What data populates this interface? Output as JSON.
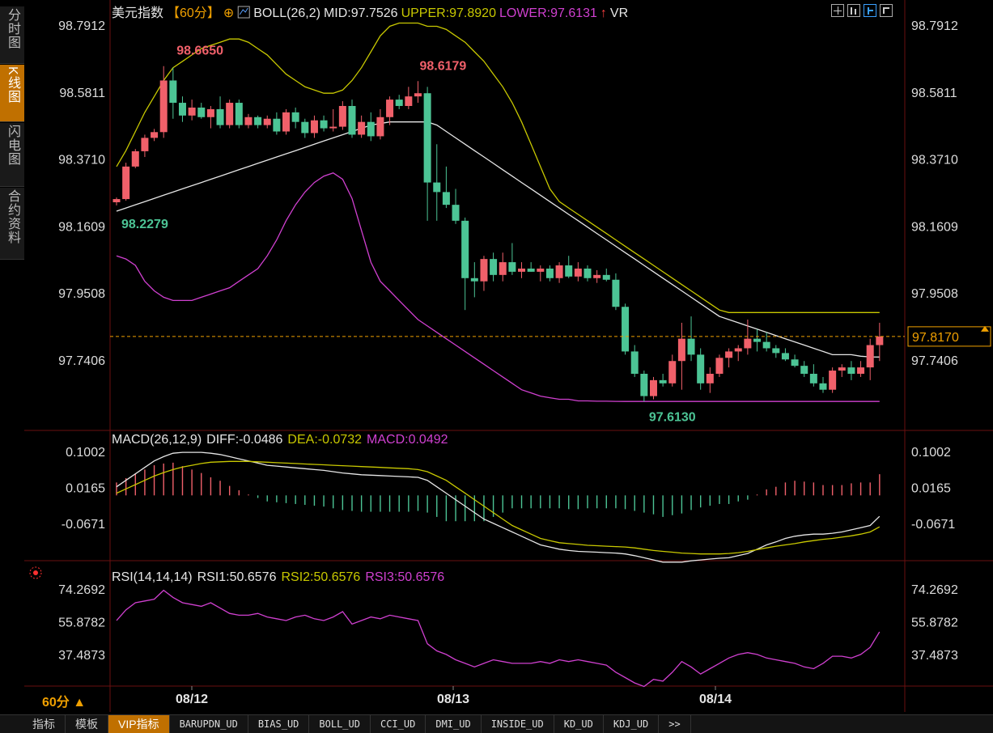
{
  "sidebar": [
    {
      "label": "分时图",
      "active": false
    },
    {
      "label": "K线图",
      "active": true
    },
    {
      "label": "闪电图",
      "active": false
    },
    {
      "label": "合约资料",
      "active": false
    }
  ],
  "header": {
    "title": "美元指数",
    "period": "【60分】",
    "plus_icon": "⊕",
    "boll_label": "BOLL(26,2)",
    "mid": "MID:97.7526",
    "upper": "UPPER:97.8920",
    "lower": "LOWER:97.6131",
    "vr_arrow": "↑",
    "vr": "VR"
  },
  "toolbar_icons": [
    "crosshair-icon",
    "bar-style-icon",
    "cursor-icon",
    "expand-icon"
  ],
  "colors": {
    "up": "#f0606a",
    "down": "#4cc495",
    "mid": "#e6e6e6",
    "upper": "#c8c800",
    "lower": "#d040d0",
    "dea": "#c8c800",
    "diff": "#e6e6e6",
    "rsi": "#d040d0",
    "last_price": "#f0a000",
    "axis_text": "#dddddd"
  },
  "main_axis": {
    "ticks": [
      "98.7912",
      "98.5811",
      "98.3710",
      "98.1609",
      "97.9508",
      "97.7406"
    ],
    "last_price": "97.8170"
  },
  "price_annotations": [
    {
      "text": "98.6650",
      "type": "high"
    },
    {
      "text": "98.6179",
      "type": "high"
    },
    {
      "text": "98.2279",
      "type": "low"
    },
    {
      "text": "97.6130",
      "type": "low"
    }
  ],
  "macd_header": {
    "label": "MACD(26,12,9)",
    "diff": "DIFF:-0.0486",
    "dea": "DEA:-0.0732",
    "macd": "MACD:0.0492"
  },
  "macd_axis": {
    "ticks": [
      "0.1002",
      "0.0165",
      "-0.0671"
    ]
  },
  "rsi_header": {
    "icon": "settings-icon",
    "label": "RSI(14,14,14)",
    "rsi1": "RSI1:50.6576",
    "rsi2": "RSI2:50.6576",
    "rsi3": "RSI3:50.6576"
  },
  "rsi_axis": {
    "ticks": [
      "74.2692",
      "55.8782",
      "37.4873"
    ]
  },
  "x_axis": {
    "period_label": "60分 ▲",
    "dates": [
      "08/12",
      "08/13",
      "08/14"
    ]
  },
  "bottom_tabs": [
    "指标",
    "模板",
    "VIP指标",
    "BARUPDN_UD",
    "BIAS_UD",
    "BOLL_UD",
    "CCI_UD",
    "DMI_UD",
    "INSIDE_UD",
    "KD_UD",
    "KDJ_UD",
    ">>"
  ],
  "chart_data": [
    {
      "type": "candlestick",
      "title": "美元指数 60分",
      "ylim": [
        97.613,
        98.7912
      ],
      "candles": [
        {
          "o": 98.238,
          "h": 98.253,
          "l": 98.228,
          "c": 98.248
        },
        {
          "o": 98.248,
          "h": 98.362,
          "l": 98.243,
          "c": 98.35
        },
        {
          "o": 98.35,
          "h": 98.405,
          "l": 98.345,
          "c": 98.398
        },
        {
          "o": 98.398,
          "h": 98.45,
          "l": 98.38,
          "c": 98.44
        },
        {
          "o": 98.44,
          "h": 98.468,
          "l": 98.43,
          "c": 98.458
        },
        {
          "o": 98.458,
          "h": 98.665,
          "l": 98.44,
          "c": 98.62
        },
        {
          "o": 98.62,
          "h": 98.66,
          "l": 98.5,
          "c": 98.55
        },
        {
          "o": 98.55,
          "h": 98.57,
          "l": 98.49,
          "c": 98.51
        },
        {
          "o": 98.51,
          "h": 98.56,
          "l": 98.495,
          "c": 98.535
        },
        {
          "o": 98.535,
          "h": 98.55,
          "l": 98.5,
          "c": 98.505
        },
        {
          "o": 98.505,
          "h": 98.54,
          "l": 98.47,
          "c": 98.53
        },
        {
          "o": 98.53,
          "h": 98.57,
          "l": 98.47,
          "c": 98.48
        },
        {
          "o": 98.48,
          "h": 98.56,
          "l": 98.47,
          "c": 98.55
        },
        {
          "o": 98.55,
          "h": 98.56,
          "l": 98.47,
          "c": 98.48
        },
        {
          "o": 98.48,
          "h": 98.515,
          "l": 98.47,
          "c": 98.505
        },
        {
          "o": 98.505,
          "h": 98.51,
          "l": 98.47,
          "c": 98.48
        },
        {
          "o": 98.48,
          "h": 98.51,
          "l": 98.47,
          "c": 98.5
        },
        {
          "o": 98.5,
          "h": 98.52,
          "l": 98.45,
          "c": 98.46
        },
        {
          "o": 98.46,
          "h": 98.53,
          "l": 98.45,
          "c": 98.52
        },
        {
          "o": 98.52,
          "h": 98.535,
          "l": 98.47,
          "c": 98.49
        },
        {
          "o": 98.49,
          "h": 98.5,
          "l": 98.44,
          "c": 98.455
        },
        {
          "o": 98.455,
          "h": 98.51,
          "l": 98.44,
          "c": 98.495
        },
        {
          "o": 98.495,
          "h": 98.51,
          "l": 98.46,
          "c": 98.47
        },
        {
          "o": 98.47,
          "h": 98.53,
          "l": 98.46,
          "c": 98.475
        },
        {
          "o": 98.475,
          "h": 98.555,
          "l": 98.465,
          "c": 98.54
        },
        {
          "o": 98.54,
          "h": 98.56,
          "l": 98.44,
          "c": 98.45
        },
        {
          "o": 98.45,
          "h": 98.51,
          "l": 98.44,
          "c": 98.49
        },
        {
          "o": 98.49,
          "h": 98.52,
          "l": 98.43,
          "c": 98.445
        },
        {
          "o": 98.445,
          "h": 98.53,
          "l": 98.435,
          "c": 98.505
        },
        {
          "o": 98.505,
          "h": 98.57,
          "l": 98.48,
          "c": 98.56
        },
        {
          "o": 98.56,
          "h": 98.575,
          "l": 98.53,
          "c": 98.54
        },
        {
          "o": 98.54,
          "h": 98.6,
          "l": 98.53,
          "c": 98.57
        },
        {
          "o": 98.57,
          "h": 98.618,
          "l": 98.55,
          "c": 98.58
        },
        {
          "o": 98.58,
          "h": 98.6,
          "l": 98.18,
          "c": 98.3
        },
        {
          "o": 98.3,
          "h": 98.42,
          "l": 98.18,
          "c": 98.27
        },
        {
          "o": 98.27,
          "h": 98.35,
          "l": 98.22,
          "c": 98.23
        },
        {
          "o": 98.23,
          "h": 98.28,
          "l": 98.17,
          "c": 98.18
        },
        {
          "o": 98.18,
          "h": 98.19,
          "l": 97.9,
          "c": 98.0
        },
        {
          "o": 98.0,
          "h": 98.05,
          "l": 97.94,
          "c": 97.99
        },
        {
          "o": 97.99,
          "h": 98.07,
          "l": 97.96,
          "c": 98.06
        },
        {
          "o": 98.06,
          "h": 98.08,
          "l": 97.99,
          "c": 98.01
        },
        {
          "o": 98.01,
          "h": 98.08,
          "l": 97.99,
          "c": 98.05
        },
        {
          "o": 98.05,
          "h": 98.11,
          "l": 98.01,
          "c": 98.02
        },
        {
          "o": 98.02,
          "h": 98.05,
          "l": 98.0,
          "c": 98.03
        },
        {
          "o": 98.03,
          "h": 98.05,
          "l": 98.02,
          "c": 98.02
        },
        {
          "o": 98.02,
          "h": 98.04,
          "l": 97.99,
          "c": 98.03
        },
        {
          "o": 98.03,
          "h": 98.04,
          "l": 97.99,
          "c": 98.0
        },
        {
          "o": 98.0,
          "h": 98.05,
          "l": 97.985,
          "c": 98.04
        },
        {
          "o": 98.04,
          "h": 98.07,
          "l": 98.0,
          "c": 98.005
        },
        {
          "o": 98.005,
          "h": 98.05,
          "l": 97.99,
          "c": 98.03
        },
        {
          "o": 98.03,
          "h": 98.04,
          "l": 97.99,
          "c": 98.0
        },
        {
          "o": 98.0,
          "h": 98.025,
          "l": 97.985,
          "c": 98.01
        },
        {
          "o": 98.01,
          "h": 98.03,
          "l": 97.99,
          "c": 97.995
        },
        {
          "o": 97.995,
          "h": 98.015,
          "l": 97.9,
          "c": 97.91
        },
        {
          "o": 97.91,
          "h": 97.92,
          "l": 97.76,
          "c": 97.77
        },
        {
          "o": 97.77,
          "h": 97.79,
          "l": 97.69,
          "c": 97.7
        },
        {
          "o": 97.7,
          "h": 97.71,
          "l": 97.613,
          "c": 97.63
        },
        {
          "o": 97.63,
          "h": 97.69,
          "l": 97.62,
          "c": 97.68
        },
        {
          "o": 97.68,
          "h": 97.7,
          "l": 97.66,
          "c": 97.67
        },
        {
          "o": 97.67,
          "h": 97.76,
          "l": 97.66,
          "c": 97.74
        },
        {
          "o": 97.74,
          "h": 97.86,
          "l": 97.65,
          "c": 97.81
        },
        {
          "o": 97.81,
          "h": 97.88,
          "l": 97.74,
          "c": 97.76
        },
        {
          "o": 97.76,
          "h": 97.78,
          "l": 97.65,
          "c": 97.67
        },
        {
          "o": 97.67,
          "h": 97.72,
          "l": 97.64,
          "c": 97.7
        },
        {
          "o": 97.7,
          "h": 97.76,
          "l": 97.69,
          "c": 97.75
        },
        {
          "o": 97.75,
          "h": 97.78,
          "l": 97.72,
          "c": 97.77
        },
        {
          "o": 97.77,
          "h": 97.79,
          "l": 97.74,
          "c": 97.78
        },
        {
          "o": 97.78,
          "h": 97.87,
          "l": 97.76,
          "c": 97.81
        },
        {
          "o": 97.81,
          "h": 97.84,
          "l": 97.77,
          "c": 97.8
        },
        {
          "o": 97.8,
          "h": 97.83,
          "l": 97.77,
          "c": 97.78
        },
        {
          "o": 97.78,
          "h": 97.79,
          "l": 97.75,
          "c": 97.765
        },
        {
          "o": 97.765,
          "h": 97.78,
          "l": 97.74,
          "c": 97.745
        },
        {
          "o": 97.745,
          "h": 97.76,
          "l": 97.72,
          "c": 97.725
        },
        {
          "o": 97.725,
          "h": 97.74,
          "l": 97.69,
          "c": 97.7
        },
        {
          "o": 97.7,
          "h": 97.73,
          "l": 97.66,
          "c": 97.67
        },
        {
          "o": 97.67,
          "h": 97.69,
          "l": 97.64,
          "c": 97.65
        },
        {
          "o": 97.65,
          "h": 97.72,
          "l": 97.64,
          "c": 97.71
        },
        {
          "o": 97.71,
          "h": 97.73,
          "l": 97.69,
          "c": 97.72
        },
        {
          "o": 97.72,
          "h": 97.74,
          "l": 97.68,
          "c": 97.7
        },
        {
          "o": 97.7,
          "h": 97.74,
          "l": 97.69,
          "c": 97.72
        },
        {
          "o": 97.72,
          "h": 97.81,
          "l": 97.68,
          "c": 97.79
        },
        {
          "o": 97.79,
          "h": 97.86,
          "l": 97.74,
          "c": 97.817
        }
      ],
      "mid": [
        98.21,
        98.22,
        98.23,
        98.24,
        98.25,
        98.26,
        98.27,
        98.28,
        98.29,
        98.3,
        98.31,
        98.32,
        98.33,
        98.34,
        98.35,
        98.36,
        98.37,
        98.38,
        98.39,
        98.4,
        98.41,
        98.42,
        98.43,
        98.44,
        98.45,
        98.46,
        98.47,
        98.48,
        98.485,
        98.49,
        98.49,
        98.49,
        98.49,
        98.49,
        98.48,
        98.46,
        98.44,
        98.42,
        98.4,
        98.38,
        98.36,
        98.34,
        98.32,
        98.3,
        98.28,
        98.26,
        98.24,
        98.22,
        98.2,
        98.18,
        98.16,
        98.14,
        98.12,
        98.1,
        98.08,
        98.06,
        98.04,
        98.02,
        98.0,
        97.98,
        97.96,
        97.94,
        97.92,
        97.9,
        97.88,
        97.87,
        97.86,
        97.85,
        97.84,
        97.83,
        97.82,
        97.81,
        97.8,
        97.79,
        97.78,
        97.77,
        97.76,
        97.76,
        97.76,
        97.755,
        97.753,
        97.7526
      ],
      "upper": [
        98.35,
        98.4,
        98.46,
        98.52,
        98.57,
        98.62,
        98.66,
        98.68,
        98.7,
        98.72,
        98.73,
        98.74,
        98.75,
        98.75,
        98.74,
        98.72,
        98.7,
        98.67,
        98.64,
        98.62,
        98.6,
        98.59,
        98.58,
        98.58,
        98.59,
        98.62,
        98.66,
        98.71,
        98.76,
        98.79,
        98.8,
        98.8,
        98.8,
        98.79,
        98.79,
        98.78,
        98.76,
        98.74,
        98.71,
        98.68,
        98.64,
        98.6,
        98.55,
        98.49,
        98.42,
        98.35,
        98.28,
        98.24,
        98.22,
        98.2,
        98.18,
        98.16,
        98.14,
        98.12,
        98.1,
        98.08,
        98.06,
        98.04,
        98.02,
        98.0,
        97.98,
        97.96,
        97.94,
        97.92,
        97.9,
        97.892,
        97.892,
        97.892,
        97.892,
        97.892,
        97.892,
        97.892,
        97.892,
        97.892,
        97.892,
        97.892,
        97.892,
        97.892,
        97.892,
        97.892,
        97.892,
        97.892
      ],
      "lower": [
        98.07,
        98.06,
        98.04,
        97.99,
        97.96,
        97.94,
        97.93,
        97.93,
        97.93,
        97.94,
        97.95,
        97.96,
        97.97,
        97.99,
        98.01,
        98.03,
        98.07,
        98.12,
        98.18,
        98.23,
        98.27,
        98.3,
        98.32,
        98.33,
        98.31,
        98.25,
        98.15,
        98.05,
        97.99,
        97.96,
        97.93,
        97.9,
        97.87,
        97.85,
        97.83,
        97.81,
        97.79,
        97.77,
        97.75,
        97.73,
        97.71,
        97.69,
        97.67,
        97.65,
        97.64,
        97.63,
        97.625,
        97.62,
        97.62,
        97.615,
        97.615,
        97.614,
        97.614,
        97.6135,
        97.6133,
        97.6131,
        97.6131,
        97.6131,
        97.6131,
        97.6131,
        97.6131,
        97.6131,
        97.6131,
        97.6131,
        97.6131,
        97.6131,
        97.6131,
        97.6131,
        97.6131,
        97.6131,
        97.6131,
        97.6131,
        97.6131,
        97.6131,
        97.6131,
        97.6131,
        97.6131,
        97.6131,
        97.6131,
        97.6131,
        97.6131,
        97.6131
      ]
    },
    {
      "type": "line",
      "title": "MACD(26,12,9)",
      "ylim": [
        -0.0671,
        0.1002
      ],
      "diff_end": -0.0486,
      "dea_end": -0.0732,
      "macd_end": 0.0492,
      "diff": [
        0.02,
        0.035,
        0.05,
        0.065,
        0.08,
        0.09,
        0.098,
        0.1,
        0.1,
        0.1,
        0.098,
        0.095,
        0.09,
        0.085,
        0.08,
        0.075,
        0.07,
        0.068,
        0.066,
        0.064,
        0.062,
        0.06,
        0.058,
        0.055,
        0.052,
        0.05,
        0.048,
        0.047,
        0.046,
        0.045,
        0.044,
        0.043,
        0.042,
        0.035,
        0.02,
        0.005,
        -0.01,
        -0.025,
        -0.04,
        -0.055,
        -0.065,
        -0.075,
        -0.085,
        -0.095,
        -0.105,
        -0.115,
        -0.12,
        -0.125,
        -0.128,
        -0.13,
        -0.131,
        -0.132,
        -0.133,
        -0.134,
        -0.136,
        -0.14,
        -0.145,
        -0.15,
        -0.155,
        -0.155,
        -0.155,
        -0.152,
        -0.15,
        -0.148,
        -0.146,
        -0.145,
        -0.14,
        -0.135,
        -0.125,
        -0.115,
        -0.108,
        -0.1,
        -0.095,
        -0.092,
        -0.09,
        -0.09,
        -0.088,
        -0.085,
        -0.08,
        -0.075,
        -0.07,
        -0.0486
      ],
      "dea": [
        0.005,
        0.015,
        0.025,
        0.035,
        0.045,
        0.053,
        0.06,
        0.066,
        0.07,
        0.074,
        0.077,
        0.078,
        0.079,
        0.079,
        0.079,
        0.078,
        0.077,
        0.076,
        0.075,
        0.074,
        0.073,
        0.072,
        0.071,
        0.07,
        0.069,
        0.068,
        0.067,
        0.066,
        0.065,
        0.064,
        0.063,
        0.062,
        0.06,
        0.055,
        0.045,
        0.035,
        0.02,
        0.005,
        -0.01,
        -0.025,
        -0.04,
        -0.055,
        -0.07,
        -0.08,
        -0.09,
        -0.1,
        -0.105,
        -0.11,
        -0.112,
        -0.114,
        -0.116,
        -0.117,
        -0.118,
        -0.119,
        -0.12,
        -0.122,
        -0.125,
        -0.128,
        -0.13,
        -0.132,
        -0.134,
        -0.135,
        -0.136,
        -0.136,
        -0.136,
        -0.135,
        -0.133,
        -0.13,
        -0.126,
        -0.122,
        -0.118,
        -0.115,
        -0.112,
        -0.108,
        -0.105,
        -0.102,
        -0.1,
        -0.097,
        -0.094,
        -0.09,
        -0.085,
        -0.0732
      ]
    },
    {
      "type": "line",
      "title": "RSI(14,14,14)",
      "ylim": [
        37.4873,
        74.2692
      ],
      "rsi": [
        57,
        63,
        67,
        68,
        69,
        74,
        70,
        67,
        66,
        65,
        67,
        64,
        61,
        60,
        60,
        61,
        59,
        58,
        57,
        59,
        60,
        58,
        57,
        59,
        62,
        55,
        57,
        59,
        58,
        60,
        59,
        58,
        57,
        44,
        40,
        38,
        35,
        33,
        31,
        33,
        35,
        34,
        33,
        33,
        33,
        34,
        33,
        35,
        34,
        35,
        34,
        33,
        32,
        28,
        25,
        22,
        20,
        24,
        23,
        28,
        34,
        31,
        27,
        30,
        33,
        36,
        38,
        39,
        38,
        36,
        35,
        34,
        33,
        31,
        30,
        33,
        37,
        37,
        36,
        38,
        42,
        50.6576
      ]
    }
  ]
}
